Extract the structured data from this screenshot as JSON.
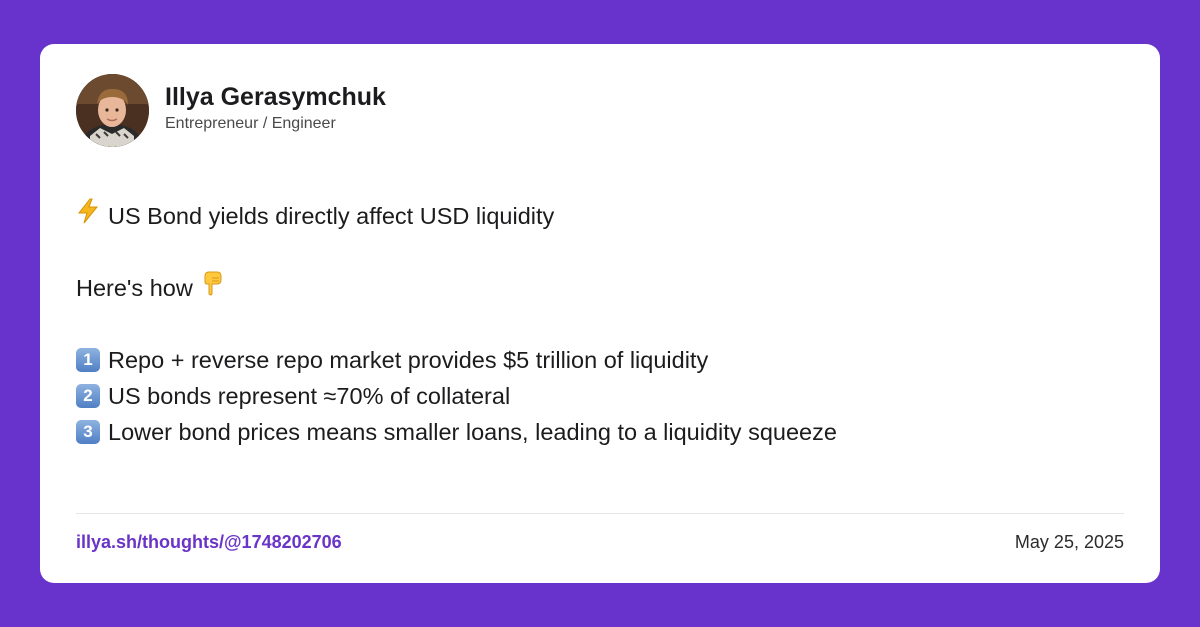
{
  "author": {
    "name": "Illya Gerasymchuk",
    "role": "Entrepreneur / Engineer",
    "avatar_icon": "avatar-photo-icon"
  },
  "post": {
    "headline_emoji": "lightning-icon",
    "headline": "US Bond yields directly affect USD liquidity",
    "intro": "Here's how",
    "intro_emoji": "pointing-down-icon",
    "points": [
      {
        "badge": "1",
        "text": "Repo + reverse repo market provides $5 trillion of liquidity"
      },
      {
        "badge": "2",
        "text": "US bonds represent ≈70% of collateral"
      },
      {
        "badge": "3",
        "text": "Lower bond prices means smaller loans, leading to a liquidity squeeze"
      }
    ]
  },
  "footer": {
    "link": "illya.sh/thoughts/@1748202706",
    "date": "May 25, 2025"
  },
  "colors": {
    "background": "#6733cc",
    "card": "#ffffff",
    "link": "#6a34c8",
    "keycap": "#5b8bd0"
  }
}
